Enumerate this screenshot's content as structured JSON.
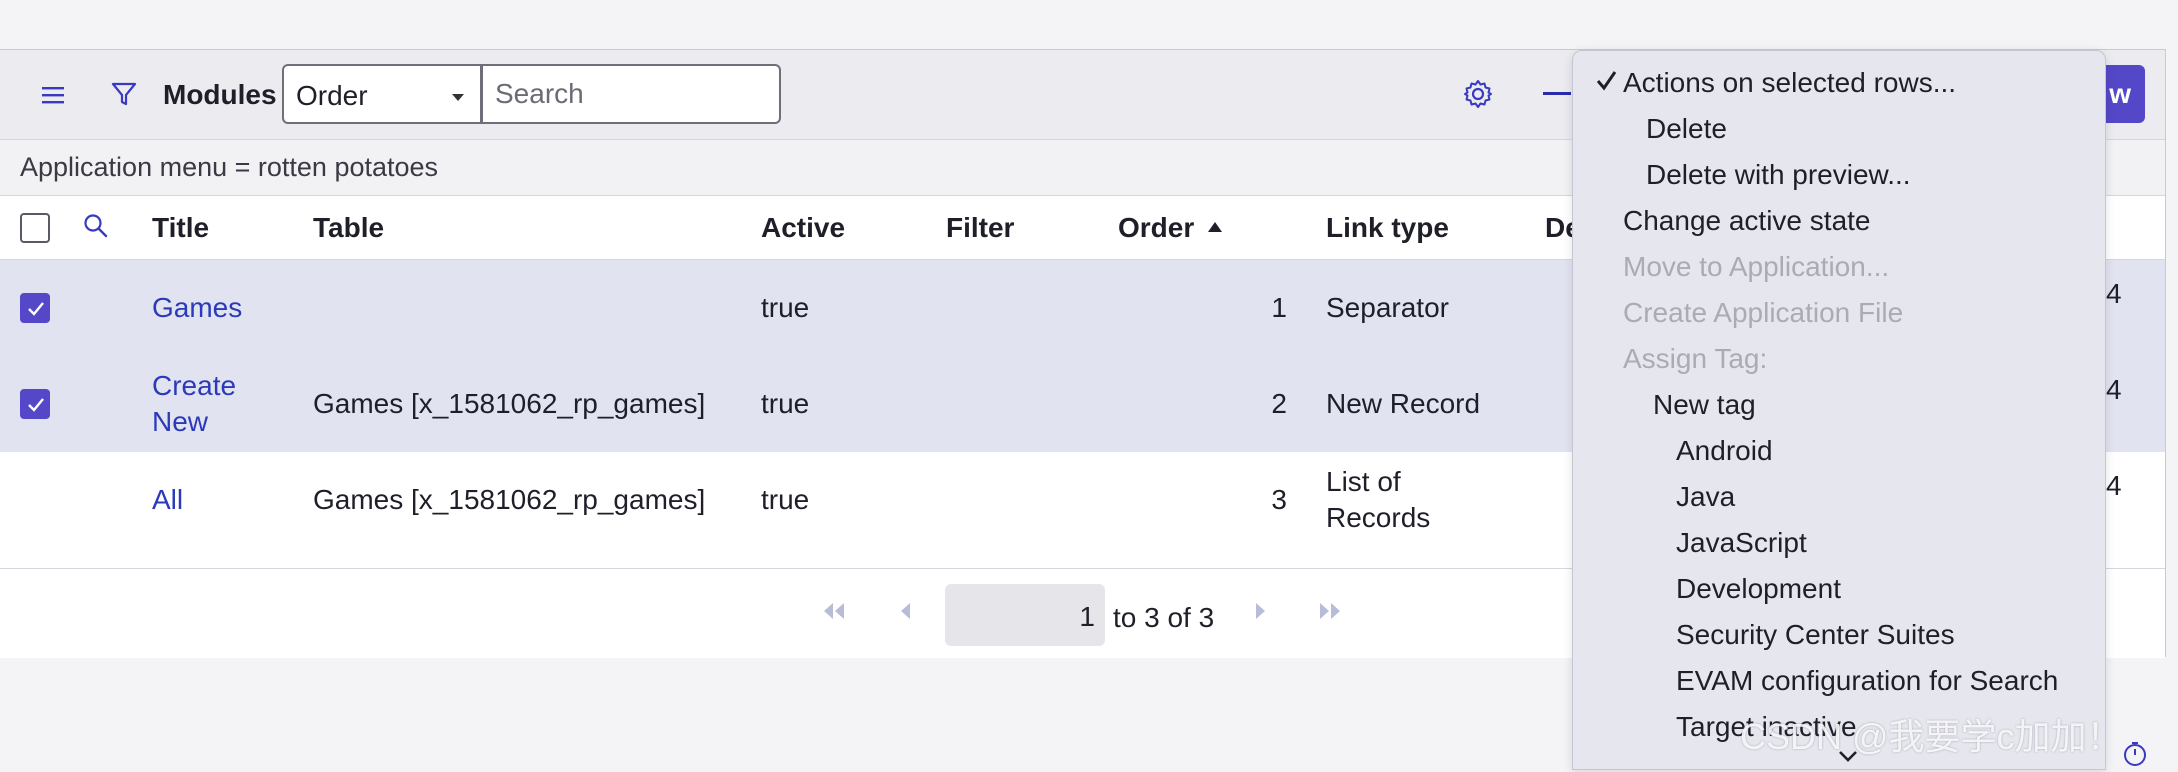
{
  "toolbar": {
    "modules_label": "Modules",
    "order_select": "Order",
    "search_placeholder": "Search",
    "new_button": "w"
  },
  "breadcrumb": "Application menu = rotten potatoes",
  "columns": [
    "Title",
    "Table",
    "Active",
    "Filter",
    "Order",
    "Link type",
    "De"
  ],
  "rows": [
    {
      "selected": true,
      "title": "Games",
      "table": "",
      "active": "true",
      "filter": "",
      "order": "1",
      "link_type": "Separator",
      "extra": "4"
    },
    {
      "selected": true,
      "title": "Create New",
      "title_l1": "Create",
      "title_l2": "New",
      "table": "Games [x_1581062_rp_games]",
      "active": "true",
      "filter": "",
      "order": "2",
      "link_type": "New Record",
      "extra": "4"
    },
    {
      "selected": false,
      "title": "All",
      "table": "Games [x_1581062_rp_games]",
      "active": "true",
      "filter": "",
      "order": "3",
      "link_type": "List of Records",
      "link_type_l1": "List of",
      "link_type_l2": "Records",
      "extra": "4"
    }
  ],
  "pager": {
    "page": "1",
    "of_text": "to 3 of 3"
  },
  "context_menu": {
    "header": "Actions on selected rows...",
    "items": [
      {
        "label": "Delete",
        "disabled": false
      },
      {
        "label": "Delete with preview...",
        "disabled": false
      },
      {
        "label": "Change active state",
        "disabled": false
      },
      {
        "label": "Move to Application...",
        "disabled": true
      },
      {
        "label": "Create Application File",
        "disabled": true
      },
      {
        "label": "Assign Tag:",
        "disabled": true
      },
      {
        "label": "New tag",
        "disabled": false
      },
      {
        "label": "Android",
        "disabled": false
      },
      {
        "label": "Java",
        "disabled": false
      },
      {
        "label": "JavaScript",
        "disabled": false
      },
      {
        "label": "Development",
        "disabled": false
      },
      {
        "label": "Security Center Suites",
        "disabled": false
      },
      {
        "label": "EVAM configuration for Search",
        "disabled": false
      },
      {
        "label": "Target inactive",
        "disabled": false
      }
    ]
  },
  "watermark": "CSDN @我要学c加加！",
  "colors": {
    "accent": "#5448c8",
    "link": "#2a3ab8",
    "selected_row": "#e2e3f1",
    "menu_bg": "#e6e7ee",
    "disabled_text": "#a9abb5"
  },
  "icons": [
    "hamburger-menu-icon",
    "filter-icon",
    "gear-icon",
    "search-icon",
    "sort-ascending-icon",
    "first-page-icon",
    "previous-page-icon",
    "next-page-icon",
    "last-page-icon",
    "checkmark-icon",
    "chevron-down-icon",
    "clock-icon"
  ]
}
